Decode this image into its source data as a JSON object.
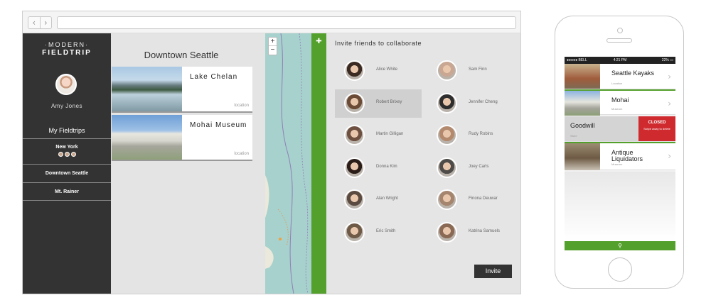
{
  "browser": {
    "back_icon": "chevron-left-icon",
    "forward_icon": "chevron-right-icon",
    "url": ""
  },
  "sidebar": {
    "logo_line1": "·MODERN·",
    "logo_line2": "FIELDTRIP",
    "user_name": "Amy Jones",
    "section_title": "My Fieldtrips",
    "trips": [
      {
        "label": "New York"
      },
      {
        "label": "Downtown Seattle"
      },
      {
        "label": "Mt. Rainer"
      }
    ]
  },
  "trip": {
    "title": "Downtown Seattle",
    "locations": [
      {
        "name": "Lake Chelan",
        "sub": "location"
      },
      {
        "name": "Mohai Museum",
        "sub": "location"
      }
    ]
  },
  "map": {
    "zoom_in": "+",
    "zoom_out": "−"
  },
  "invite": {
    "title": "Invite friends to collaborate",
    "add_icon": "add-user-icon",
    "friends": [
      {
        "name": "Alice White",
        "color": "#3a2a22"
      },
      {
        "name": "Sam Finn",
        "color": "#c9a792"
      },
      {
        "name": "Robert Brixey",
        "color": "#6b4b35"
      },
      {
        "name": "Jennifer Cheng",
        "color": "#2e2e2e"
      },
      {
        "name": "Martin Gilligan",
        "color": "#6e5040"
      },
      {
        "name": "Rudy Robins",
        "color": "#b48a6e"
      },
      {
        "name": "Donna Kim",
        "color": "#2b1e19"
      },
      {
        "name": "Joey Carls",
        "color": "#4e4b49"
      },
      {
        "name": "Alan Wright",
        "color": "#5a4a3f"
      },
      {
        "name": "Finona Deuwar",
        "color": "#a5856e"
      },
      {
        "name": "Eric Smith",
        "color": "#6f5a48"
      },
      {
        "name": "Katrina Samuels",
        "color": "#8a6a55"
      }
    ],
    "selected": "Robert Brixey",
    "button_label": "Invite"
  },
  "phone": {
    "status": {
      "carrier": "●●●●● BELL ",
      "time": "4:21 PM",
      "battery": "22% ▭"
    },
    "items": [
      {
        "title": "Seattle Kayaks",
        "sub": "Location"
      },
      {
        "title": "Mohai",
        "sub": "Museum"
      },
      {
        "title": "Goodwill",
        "sub": "Store",
        "closed_label": "CLOSED",
        "swipe_hint": "Swipe away to delete"
      },
      {
        "title": "Antique Liquidators",
        "sub": "Museum"
      }
    ],
    "footer_icon": "location-pin-icon"
  },
  "colors": {
    "accent_green": "#54a02c",
    "sidebar": "#333333",
    "closed_red": "#cf2a2e"
  }
}
